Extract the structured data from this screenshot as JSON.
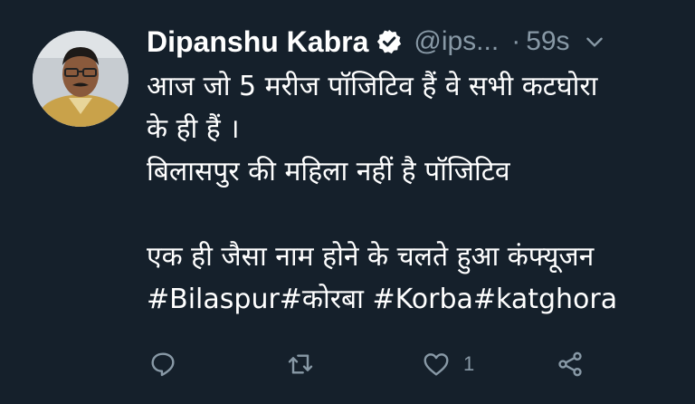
{
  "tweet": {
    "author_name": "Dipanshu Kabra",
    "handle": "@ips...",
    "separator": "·",
    "time": "59s",
    "lines": [
      "आज जो 5 मरीज पॉजिटिव हैं वे सभी कटघोरा",
      "के ही हैं ।",
      "बिलासपुर की महिला नहीं है पॉजिटिव",
      "",
      "एक ही जैसा नाम होने के चलते हुआ कंफ्यूजन",
      "#Bilaspur#कोरबा #Korba#katghora"
    ],
    "like_count": "1"
  },
  "colors": {
    "background": "#15202b",
    "text": "#ffffff",
    "secondary": "#8899a6",
    "verified_badge": "#ffffff"
  },
  "icons": [
    "verified-badge-icon",
    "chevron-down-icon",
    "reply-icon",
    "retweet-icon",
    "like-icon",
    "share-icon"
  ]
}
